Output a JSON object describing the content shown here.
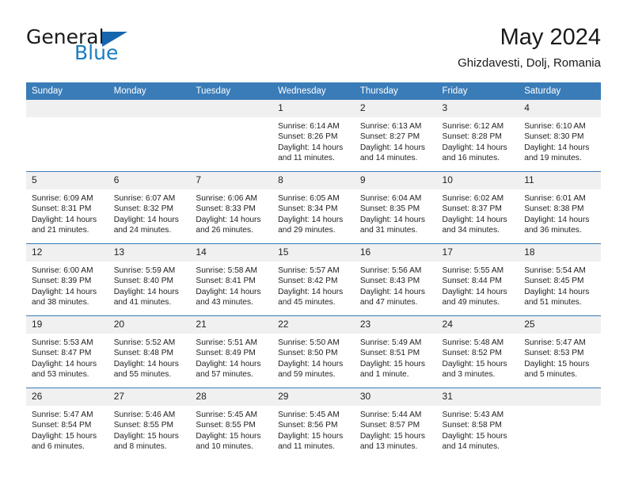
{
  "brand": {
    "name_primary": "General",
    "name_secondary": "Blue",
    "flag_icon": "blue-triangle-flag-icon"
  },
  "header": {
    "title": "May 2024",
    "location": "Ghizdavesti, Dolj, Romania"
  },
  "colors": {
    "header_blue": "#3a7cb8",
    "brand_blue": "#1a7cc0",
    "daynum_band": "#f0f0f0",
    "text": "#222222"
  },
  "calendar": {
    "weekday_headers": [
      "Sunday",
      "Monday",
      "Tuesday",
      "Wednesday",
      "Thursday",
      "Friday",
      "Saturday"
    ],
    "labels": {
      "sunrise_prefix": "Sunrise:",
      "sunset_prefix": "Sunset:",
      "daylight_prefix": "Daylight:"
    },
    "weeks": [
      [
        {
          "day": "",
          "blank": true
        },
        {
          "day": "",
          "blank": true
        },
        {
          "day": "",
          "blank": true
        },
        {
          "day": "1",
          "sunrise": "Sunrise: 6:14 AM",
          "sunset": "Sunset: 8:26 PM",
          "daylight_1": "Daylight: 14 hours",
          "daylight_2": "and 11 minutes."
        },
        {
          "day": "2",
          "sunrise": "Sunrise: 6:13 AM",
          "sunset": "Sunset: 8:27 PM",
          "daylight_1": "Daylight: 14 hours",
          "daylight_2": "and 14 minutes."
        },
        {
          "day": "3",
          "sunrise": "Sunrise: 6:12 AM",
          "sunset": "Sunset: 8:28 PM",
          "daylight_1": "Daylight: 14 hours",
          "daylight_2": "and 16 minutes."
        },
        {
          "day": "4",
          "sunrise": "Sunrise: 6:10 AM",
          "sunset": "Sunset: 8:30 PM",
          "daylight_1": "Daylight: 14 hours",
          "daylight_2": "and 19 minutes."
        }
      ],
      [
        {
          "day": "5",
          "sunrise": "Sunrise: 6:09 AM",
          "sunset": "Sunset: 8:31 PM",
          "daylight_1": "Daylight: 14 hours",
          "daylight_2": "and 21 minutes."
        },
        {
          "day": "6",
          "sunrise": "Sunrise: 6:07 AM",
          "sunset": "Sunset: 8:32 PM",
          "daylight_1": "Daylight: 14 hours",
          "daylight_2": "and 24 minutes."
        },
        {
          "day": "7",
          "sunrise": "Sunrise: 6:06 AM",
          "sunset": "Sunset: 8:33 PM",
          "daylight_1": "Daylight: 14 hours",
          "daylight_2": "and 26 minutes."
        },
        {
          "day": "8",
          "sunrise": "Sunrise: 6:05 AM",
          "sunset": "Sunset: 8:34 PM",
          "daylight_1": "Daylight: 14 hours",
          "daylight_2": "and 29 minutes."
        },
        {
          "day": "9",
          "sunrise": "Sunrise: 6:04 AM",
          "sunset": "Sunset: 8:35 PM",
          "daylight_1": "Daylight: 14 hours",
          "daylight_2": "and 31 minutes."
        },
        {
          "day": "10",
          "sunrise": "Sunrise: 6:02 AM",
          "sunset": "Sunset: 8:37 PM",
          "daylight_1": "Daylight: 14 hours",
          "daylight_2": "and 34 minutes."
        },
        {
          "day": "11",
          "sunrise": "Sunrise: 6:01 AM",
          "sunset": "Sunset: 8:38 PM",
          "daylight_1": "Daylight: 14 hours",
          "daylight_2": "and 36 minutes."
        }
      ],
      [
        {
          "day": "12",
          "sunrise": "Sunrise: 6:00 AM",
          "sunset": "Sunset: 8:39 PM",
          "daylight_1": "Daylight: 14 hours",
          "daylight_2": "and 38 minutes."
        },
        {
          "day": "13",
          "sunrise": "Sunrise: 5:59 AM",
          "sunset": "Sunset: 8:40 PM",
          "daylight_1": "Daylight: 14 hours",
          "daylight_2": "and 41 minutes."
        },
        {
          "day": "14",
          "sunrise": "Sunrise: 5:58 AM",
          "sunset": "Sunset: 8:41 PM",
          "daylight_1": "Daylight: 14 hours",
          "daylight_2": "and 43 minutes."
        },
        {
          "day": "15",
          "sunrise": "Sunrise: 5:57 AM",
          "sunset": "Sunset: 8:42 PM",
          "daylight_1": "Daylight: 14 hours",
          "daylight_2": "and 45 minutes."
        },
        {
          "day": "16",
          "sunrise": "Sunrise: 5:56 AM",
          "sunset": "Sunset: 8:43 PM",
          "daylight_1": "Daylight: 14 hours",
          "daylight_2": "and 47 minutes."
        },
        {
          "day": "17",
          "sunrise": "Sunrise: 5:55 AM",
          "sunset": "Sunset: 8:44 PM",
          "daylight_1": "Daylight: 14 hours",
          "daylight_2": "and 49 minutes."
        },
        {
          "day": "18",
          "sunrise": "Sunrise: 5:54 AM",
          "sunset": "Sunset: 8:45 PM",
          "daylight_1": "Daylight: 14 hours",
          "daylight_2": "and 51 minutes."
        }
      ],
      [
        {
          "day": "19",
          "sunrise": "Sunrise: 5:53 AM",
          "sunset": "Sunset: 8:47 PM",
          "daylight_1": "Daylight: 14 hours",
          "daylight_2": "and 53 minutes."
        },
        {
          "day": "20",
          "sunrise": "Sunrise: 5:52 AM",
          "sunset": "Sunset: 8:48 PM",
          "daylight_1": "Daylight: 14 hours",
          "daylight_2": "and 55 minutes."
        },
        {
          "day": "21",
          "sunrise": "Sunrise: 5:51 AM",
          "sunset": "Sunset: 8:49 PM",
          "daylight_1": "Daylight: 14 hours",
          "daylight_2": "and 57 minutes."
        },
        {
          "day": "22",
          "sunrise": "Sunrise: 5:50 AM",
          "sunset": "Sunset: 8:50 PM",
          "daylight_1": "Daylight: 14 hours",
          "daylight_2": "and 59 minutes."
        },
        {
          "day": "23",
          "sunrise": "Sunrise: 5:49 AM",
          "sunset": "Sunset: 8:51 PM",
          "daylight_1": "Daylight: 15 hours",
          "daylight_2": "and 1 minute."
        },
        {
          "day": "24",
          "sunrise": "Sunrise: 5:48 AM",
          "sunset": "Sunset: 8:52 PM",
          "daylight_1": "Daylight: 15 hours",
          "daylight_2": "and 3 minutes."
        },
        {
          "day": "25",
          "sunrise": "Sunrise: 5:47 AM",
          "sunset": "Sunset: 8:53 PM",
          "daylight_1": "Daylight: 15 hours",
          "daylight_2": "and 5 minutes."
        }
      ],
      [
        {
          "day": "26",
          "sunrise": "Sunrise: 5:47 AM",
          "sunset": "Sunset: 8:54 PM",
          "daylight_1": "Daylight: 15 hours",
          "daylight_2": "and 6 minutes."
        },
        {
          "day": "27",
          "sunrise": "Sunrise: 5:46 AM",
          "sunset": "Sunset: 8:55 PM",
          "daylight_1": "Daylight: 15 hours",
          "daylight_2": "and 8 minutes."
        },
        {
          "day": "28",
          "sunrise": "Sunrise: 5:45 AM",
          "sunset": "Sunset: 8:55 PM",
          "daylight_1": "Daylight: 15 hours",
          "daylight_2": "and 10 minutes."
        },
        {
          "day": "29",
          "sunrise": "Sunrise: 5:45 AM",
          "sunset": "Sunset: 8:56 PM",
          "daylight_1": "Daylight: 15 hours",
          "daylight_2": "and 11 minutes."
        },
        {
          "day": "30",
          "sunrise": "Sunrise: 5:44 AM",
          "sunset": "Sunset: 8:57 PM",
          "daylight_1": "Daylight: 15 hours",
          "daylight_2": "and 13 minutes."
        },
        {
          "day": "31",
          "sunrise": "Sunrise: 5:43 AM",
          "sunset": "Sunset: 8:58 PM",
          "daylight_1": "Daylight: 15 hours",
          "daylight_2": "and 14 minutes."
        },
        {
          "day": "",
          "blank": true
        }
      ]
    ]
  }
}
